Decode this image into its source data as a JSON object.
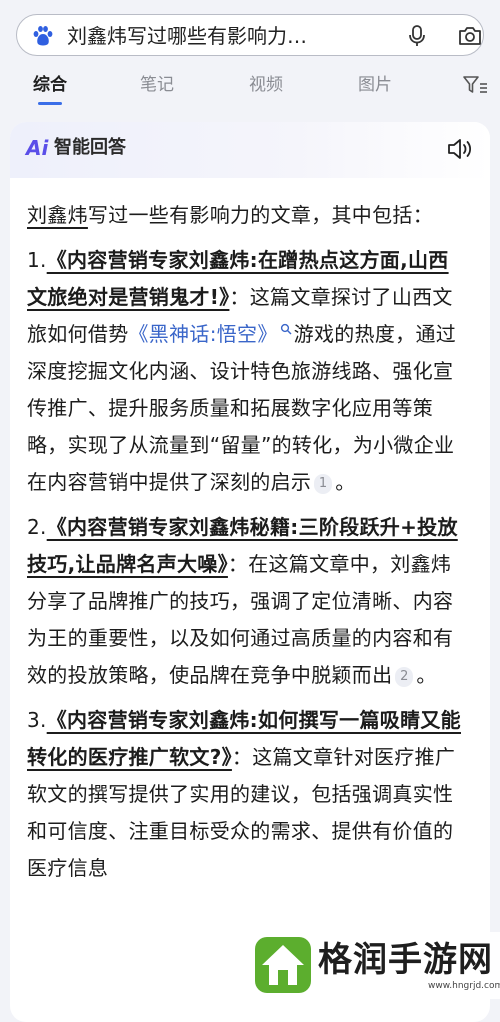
{
  "search": {
    "query": "刘鑫炜写过哪些有影响力…",
    "left_icon": "paw-logo-icon",
    "mic_icon": "microphone-icon",
    "camera_icon": "camera-icon"
  },
  "tabs": [
    {
      "label": "综合",
      "active": true
    },
    {
      "label": "笔记",
      "active": false
    },
    {
      "label": "视频",
      "active": false
    },
    {
      "label": "图片",
      "active": false
    }
  ],
  "filter_icon": "filter-icon",
  "answer_card": {
    "logo": "Ai",
    "title": "智能回答",
    "speaker_icon": "speaker-icon",
    "intro_subject": "刘鑫炜",
    "intro_rest": "写过一些有影响力的文章，其中包括：",
    "items": [
      {
        "num": "1.",
        "title": "《内容营销专家刘鑫炜:在蹭热点这方面,山西文旅绝对是营销鬼才!》",
        "text_a": "：这篇文章探讨了山西文旅如何借势",
        "link": "《黑神话:悟空》",
        "text_b": "游戏的热度，通过深度挖掘文化内涵、设计特色旅游线路、强化宣传推广、提升服务质量和拓展数字化应用等策略，实现了从流量到“留量”的转化，为小微企业在内容营销中提供了深刻的启示",
        "cite": "1",
        "end": "。"
      },
      {
        "num": "2.",
        "title": "《内容营销专家刘鑫炜秘籍:三阶段跃升+投放技巧,让品牌名声大噪》",
        "text_a": "：在这篇文章中，刘鑫炜分享了品牌推广的技巧，强调了定位清晰、内容为王的重要性，以及如何通过高质量的内容和有效的投放策略，使品牌在竞争中脱颖而出",
        "cite": "2",
        "end": "。"
      },
      {
        "num": "3.",
        "title": "《内容营销专家刘鑫炜:如何撰写一篇吸睛又能转化的医疗推广软文?》",
        "text_a": "：这篇文章针对医疗推广软文的撰写提供了实用的建议，包括强调真实性和可信度、注重目标受众的需求、提供有价值的医疗信息"
      }
    ]
  },
  "watermark": {
    "name": "格润手游网",
    "url": "www.hngrjd.com",
    "brand_color": "#5cae2e"
  }
}
